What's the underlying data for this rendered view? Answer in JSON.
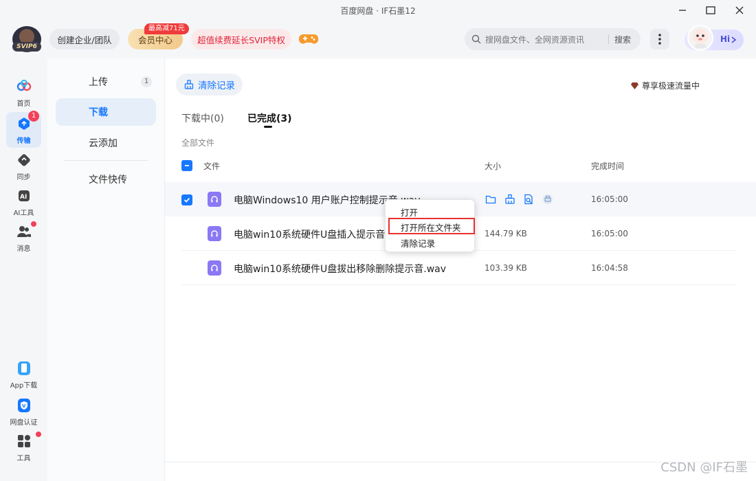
{
  "window": {
    "title": "百度网盘 · IF石墨12"
  },
  "header": {
    "svip_badge": "SVIP6",
    "team_button": "创建企业/团队",
    "member_button": "会员中心",
    "promo_tag": "最高减71元",
    "svip_promo": "超值续费延长SVIP特权",
    "search_placeholder": "搜网盘文件、全网资源资讯",
    "search_button": "搜索",
    "hi_label": "Hi"
  },
  "leftnav": {
    "items": [
      {
        "label": "首页"
      },
      {
        "label": "传输",
        "badge": "1"
      },
      {
        "label": "同步"
      },
      {
        "label": "AI工具"
      },
      {
        "label": "消息"
      },
      {
        "label": "App下载"
      },
      {
        "label": "网盘认证"
      },
      {
        "label": "工具"
      }
    ]
  },
  "subnav": {
    "items": [
      {
        "label": "上传",
        "count": "1"
      },
      {
        "label": "下载"
      },
      {
        "label": "云添加"
      },
      {
        "label": "文件快传"
      }
    ]
  },
  "main": {
    "clear_button": "清除记录",
    "speed_label": "尊享极速流量中",
    "tabs": [
      {
        "label": "下载中(0)"
      },
      {
        "label": "已完成(3)"
      }
    ],
    "all_files": "全部文件",
    "columns": {
      "name": "文件",
      "size": "大小",
      "time": "完成时间"
    },
    "rows": [
      {
        "name": "电脑Windows10 用户账户控制提示音.wav",
        "size": "",
        "time": "16:05:00"
      },
      {
        "name": "电脑win10系统硬件U盘插入提示音.wav",
        "size": "144.79 KB",
        "time": "16:05:00"
      },
      {
        "name": "电脑win10系统硬件U盘拔出移除删除提示音.wav",
        "size": "103.39 KB",
        "time": "16:04:58"
      }
    ]
  },
  "context_menu": {
    "items": [
      {
        "label": "打开"
      },
      {
        "label": "打开所在文件夹"
      },
      {
        "label": "清除记录"
      }
    ]
  },
  "watermark": "CSDN @IF石墨",
  "colors": {
    "accent": "#1677ff",
    "badge": "#f5405a",
    "highlight": "#e8302f"
  }
}
